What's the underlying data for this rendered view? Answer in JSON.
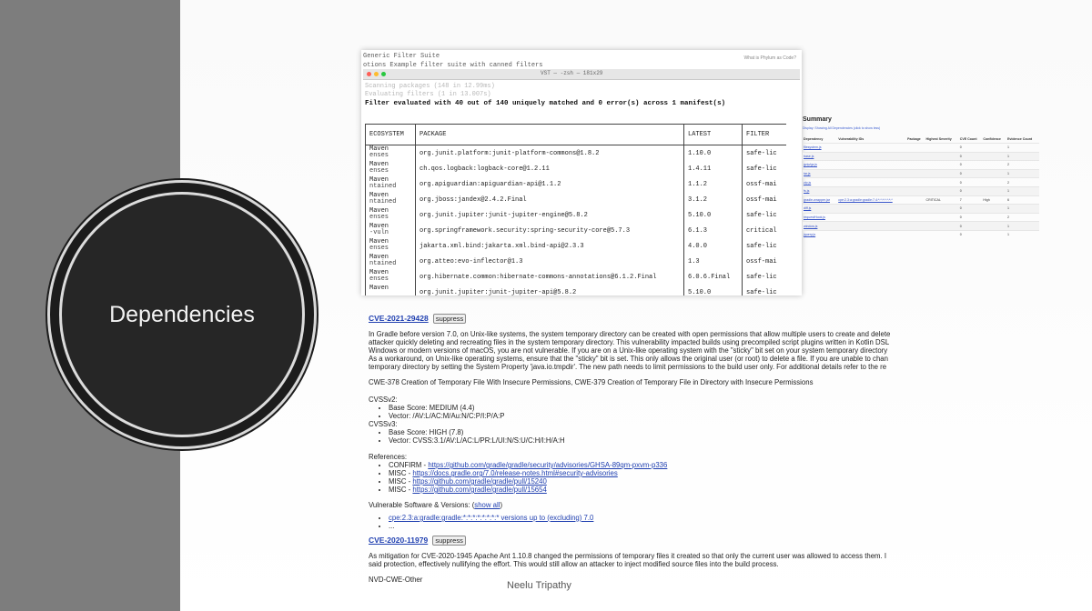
{
  "slide": {
    "title": "Dependencies",
    "footer": "Neelu Tripathy"
  },
  "terminal": {
    "line1": "Generic Filter Suite",
    "line2": "otions Example filter suite with canned filters",
    "hint": "What is Phylum as Code?",
    "window_title": "VST — -zsh — 181x29",
    "dim1": "Scanning packages        (148 in 12.99ms)",
    "dim2": "Evaluating filters       (1 in 13.007s)",
    "summary_line": "Filter evaluated with 40 out of 140 uniquely matched and 0 error(s) across 1 manifest(s)",
    "columns": [
      "ECOSYSTEM",
      "PACKAGE",
      "LATEST",
      "FILTER"
    ],
    "rows": [
      {
        "eco": "Maven",
        "eco_sub": "enses",
        "package": "org.junit.platform:junit-platform-commons@1.8.2",
        "latest": "1.10.0",
        "filter": "safe-lic"
      },
      {
        "eco": "Maven",
        "eco_sub": "enses",
        "package": "ch.qos.logback:logback-core@1.2.11",
        "latest": "1.4.11",
        "filter": "safe-lic"
      },
      {
        "eco": "Maven",
        "eco_sub": "ntained",
        "package": "org.apiguardian:apiguardian-api@1.1.2",
        "latest": "1.1.2",
        "filter": "ossf-mai"
      },
      {
        "eco": "Maven",
        "eco_sub": "ntained",
        "package": "org.jboss:jandex@2.4.2.Final",
        "latest": "3.1.2",
        "filter": "ossf-mai"
      },
      {
        "eco": "Maven",
        "eco_sub": "enses",
        "package": "org.junit.jupiter:junit-jupiter-engine@5.8.2",
        "latest": "5.10.0",
        "filter": "safe-lic"
      },
      {
        "eco": "Maven",
        "eco_sub": "-vuln",
        "package": "org.springframework.security:spring-security-core@5.7.3",
        "latest": "6.1.3",
        "filter": "critical"
      },
      {
        "eco": "Maven",
        "eco_sub": "enses",
        "package": "jakarta.xml.bind:jakarta.xml.bind-api@2.3.3",
        "latest": "4.0.0",
        "filter": "safe-lic"
      },
      {
        "eco": "Maven",
        "eco_sub": "ntained",
        "package": "org.atteo:evo-inflector@1.3",
        "latest": "1.3",
        "filter": "ossf-mai"
      },
      {
        "eco": "Maven",
        "eco_sub": "enses",
        "package": "org.hibernate.common:hibernate-commons-annotations@6.1.2.Final",
        "latest": "6.0.6.Final",
        "filter": "safe-lic"
      },
      {
        "eco": "Maven",
        "eco_sub": "",
        "package": "org.junit.jupiter:junit-jupiter-api@5.8.2",
        "latest": "5.10.0",
        "filter": "safe-lic"
      }
    ]
  },
  "summary": {
    "title": "Summary",
    "subtitle": "Display: Showing All Dependencies (click to show less)",
    "columns": [
      "Dependency",
      "Vulnerability IDs",
      "Package",
      "Highest Severity",
      "CVE Count",
      "Confidence",
      "Evidence Count"
    ],
    "rows": [
      {
        "dep": "filesystem.js",
        "vuln": "",
        "pkg": "",
        "sev": "",
        "count": "0",
        "conf": "",
        "ev": "1"
      },
      {
        "dep": "base.js",
        "vuln": "",
        "pkg": "",
        "sev": "",
        "count": "0",
        "conf": "",
        "ev": "1"
      },
      {
        "dep": "gzip/gz.js",
        "vuln": "",
        "pkg": "",
        "sev": "",
        "count": "0",
        "conf": "",
        "ev": "2"
      },
      {
        "dep": "tar.js",
        "vuln": "",
        "pkg": "",
        "sev": "",
        "count": "0",
        "conf": "",
        "ev": "1"
      },
      {
        "dep": "zip.js",
        "vuln": "",
        "pkg": "",
        "sev": "",
        "count": "0",
        "conf": "",
        "ev": "2"
      },
      {
        "dep": "fs.js",
        "vuln": "",
        "pkg": "",
        "sev": "",
        "count": "0",
        "conf": "",
        "ev": "1"
      },
      {
        "dep": "gradle-wrapper.jar",
        "vuln": "cpe:2.3:a:gradle:gradle:7.4:*:*:*:*:*:*:*",
        "pkg": "",
        "sev": "CRITICAL",
        "count": "7",
        "conf": "High",
        "ev": "6"
      },
      {
        "dep": "diff.js",
        "vuln": "",
        "pkg": "",
        "sev": "",
        "count": "0",
        "conf": "",
        "ev": "1"
      },
      {
        "dep": "requestHook.js",
        "vuln": "",
        "pkg": "",
        "sev": "",
        "count": "0",
        "conf": "",
        "ev": "2"
      },
      {
        "dep": "window.js",
        "vuln": "",
        "pkg": "",
        "sev": "",
        "count": "0",
        "conf": "",
        "ev": "1"
      },
      {
        "dep": "jquery.js",
        "vuln": "",
        "pkg": "",
        "sev": "",
        "count": "0",
        "conf": "",
        "ev": "1"
      }
    ]
  },
  "vuln": {
    "cve1": {
      "id": "CVE-2021-29428",
      "suppress": "suppress",
      "desc1": "In Gradle before version 7.0, on Unix-like systems, the system temporary directory can be created with open permissions that allow multiple users to create and delete",
      "desc2": "attacker quickly deleting and recreating files in the system temporary directory. This vulnerability impacted builds using precompiled script plugins written in Kotlin DSL",
      "desc3": "Windows or modern versions of macOS, you are not vulnerable. If you are on a Unix-like operating system with the \"sticky\" bit set on your system temporary directory",
      "desc4": "As a workaround, on Unix-like operating systems, ensure that the \"sticky\" bit is set. This only allows the original user (or root) to delete a file. If you are unable to chan",
      "desc5": "temporary directory by setting the System Property 'java.io.tmpdir'. The new path needs to limit permissions to the build user only. For additional details refer to the re",
      "cwe": "CWE-378 Creation of Temporary File With Insecure Permissions, CWE-379 Creation of Temporary File in Directory with Insecure Permissions",
      "cvss2_label": "CVSSv2:",
      "cvss2_base": "Base Score: MEDIUM (4.4)",
      "cvss2_vector": "Vector: /AV:L/AC:M/Au:N/C:P/I:P/A:P",
      "cvss3_label": "CVSSv3:",
      "cvss3_base": "Base Score: HIGH (7.8)",
      "cvss3_vector": "Vector: CVSS:3.1/AV:L/AC:L/PR:L/UI:N/S:U/C:H/I:H/A:H",
      "refs_label": "References:",
      "refs": [
        {
          "prefix": "CONFIRM - ",
          "url": "https://github.com/gradle/gradle/security/advisories/GHSA-89qm-pxvm-p336"
        },
        {
          "prefix": "MISC - ",
          "url": "https://docs.gradle.org/7.0/release-notes.html#security-advisories"
        },
        {
          "prefix": "MISC - ",
          "url": "https://github.com/gradle/gradle/pull/15240"
        },
        {
          "prefix": "MISC - ",
          "url": "https://github.com/gradle/gradle/pull/15654"
        }
      ],
      "vsv_label": "Vulnerable Software & Versions: (",
      "vsv_link": "show all",
      "vsv_close": ")",
      "cpe": "cpe:2.3:a:gradle:gradle:*:*:*:*:*:*:*:* versions up to (excluding) 7.0",
      "ellipsis": "..."
    },
    "cve2": {
      "id": "CVE-2020-11979",
      "suppress": "suppress",
      "desc1": "As mitigation for CVE-2020-1945 Apache Ant 1.10.8 changed the permissions of temporary files it created so that only the current user was allowed to access them. I",
      "desc2": "said protection, effectively nullifying the effort. This would still allow an attacker to inject modified source files into the build process.",
      "cwe": "NVD-CWE-Other"
    }
  }
}
